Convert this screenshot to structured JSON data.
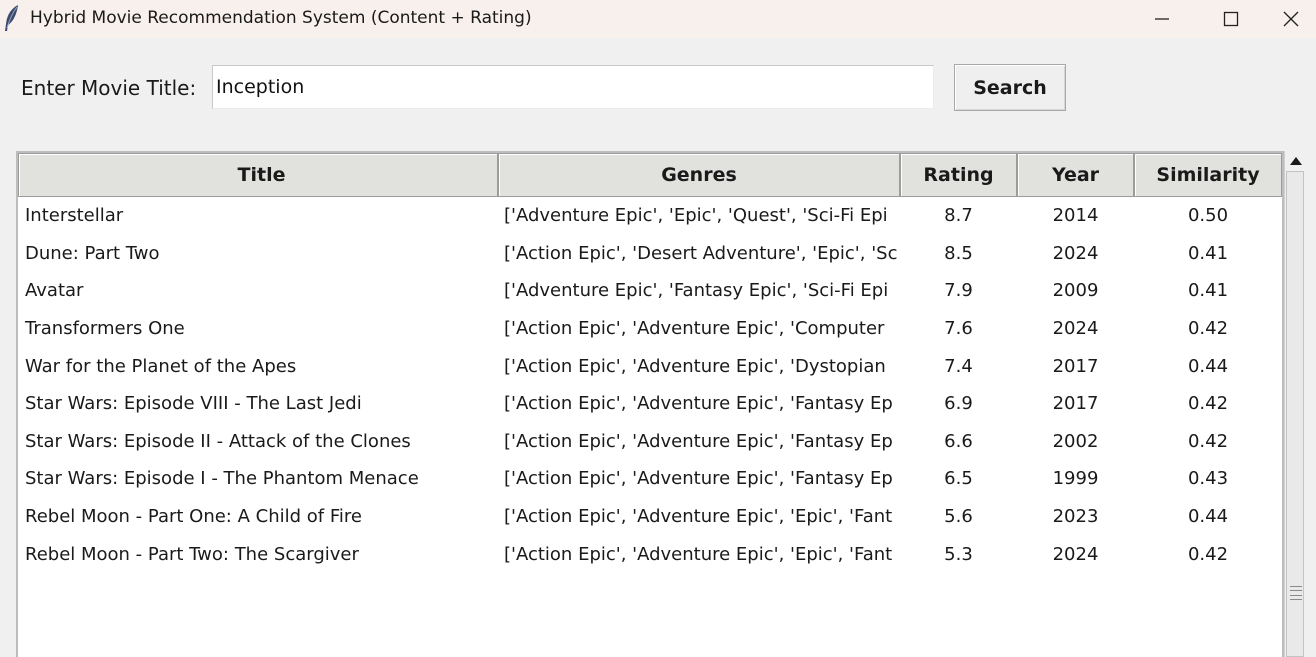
{
  "window": {
    "title": "Hybrid Movie Recommendation System (Content + Rating)"
  },
  "search": {
    "label": "Enter Movie Title:",
    "value": "Inception",
    "button_label": "Search"
  },
  "table": {
    "columns": [
      "Title",
      "Genres",
      "Rating",
      "Year",
      "Similarity"
    ],
    "rows": [
      [
        "Interstellar",
        "['Adventure Epic', 'Epic', 'Quest', 'Sci-Fi Epi",
        "8.7",
        "2014",
        "0.50"
      ],
      [
        "Dune: Part Two",
        "['Action Epic', 'Desert Adventure', 'Epic', 'Sc",
        "8.5",
        "2024",
        "0.41"
      ],
      [
        "Avatar",
        "['Adventure Epic', 'Fantasy Epic', 'Sci-Fi Epi",
        "7.9",
        "2009",
        "0.41"
      ],
      [
        "Transformers One",
        "['Action Epic', 'Adventure Epic', 'Computer",
        "7.6",
        "2024",
        "0.42"
      ],
      [
        "War for the Planet of the Apes",
        "['Action Epic', 'Adventure Epic', 'Dystopian",
        "7.4",
        "2017",
        "0.44"
      ],
      [
        "Star Wars: Episode VIII - The Last Jedi",
        "['Action Epic', 'Adventure Epic', 'Fantasy Ep",
        "6.9",
        "2017",
        "0.42"
      ],
      [
        "Star Wars: Episode II - Attack of the Clones",
        "['Action Epic', 'Adventure Epic', 'Fantasy Ep",
        "6.6",
        "2002",
        "0.42"
      ],
      [
        "Star Wars: Episode I - The Phantom Menace",
        "['Action Epic', 'Adventure Epic', 'Fantasy Ep",
        "6.5",
        "1999",
        "0.43"
      ],
      [
        "Rebel Moon - Part One: A Child of Fire",
        "['Action Epic', 'Adventure Epic', 'Epic', 'Fant",
        "5.6",
        "2023",
        "0.44"
      ],
      [
        "Rebel Moon - Part Two: The Scargiver",
        "['Action Epic', 'Adventure Epic', 'Epic', 'Fant",
        "5.3",
        "2024",
        "0.42"
      ]
    ]
  },
  "icons": {
    "app": "feather-icon",
    "minimize": "minimize-icon",
    "maximize": "maximize-icon",
    "close": "close-icon",
    "scroll_up": "scroll-up-arrow-icon"
  }
}
